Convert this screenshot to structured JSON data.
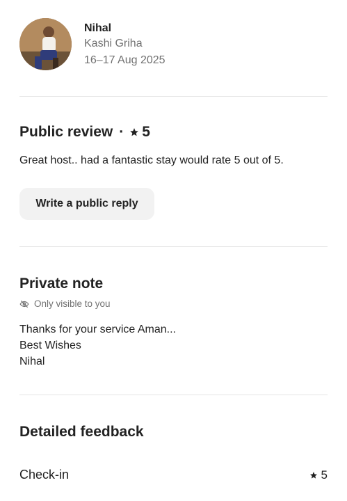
{
  "guest": {
    "name": "Nihal",
    "property": "Kashi Griha",
    "dates": "16–17 Aug 2025"
  },
  "public_review": {
    "title": "Public review",
    "separator": "·",
    "rating": "5",
    "text": "Great host.. had a fantastic stay would rate 5 out of 5.",
    "reply_button": "Write a public reply"
  },
  "private_note": {
    "title": "Private note",
    "visibility": "Only visible to you",
    "lines": [
      "Thanks for your service Aman...",
      "Best Wishes",
      "Nihal"
    ]
  },
  "detailed_feedback": {
    "title": "Detailed feedback",
    "items": [
      {
        "label": "Check-in",
        "rating": "5"
      }
    ]
  },
  "icons": {
    "star": "star-icon",
    "eye_off": "eye-off-icon"
  },
  "colors": {
    "text_primary": "#222222",
    "text_secondary": "#717171",
    "button_bg": "#f2f2f2",
    "divider": "#e5e5e5"
  }
}
